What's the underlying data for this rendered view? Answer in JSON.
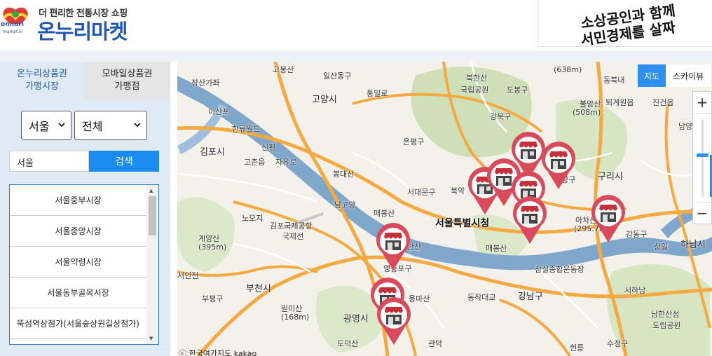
{
  "header": {
    "tagline": "더 편리한 전통시장 쇼핑",
    "brand": "온누리마켓",
    "badge_word": "onnuri",
    "badge_sub": "market.kr",
    "slogan_line1": "소상공인과 함께",
    "slogan_line2": "서민경제를 살짜"
  },
  "sidebar": {
    "tabs": [
      {
        "label": "온누리상품권\n가맹시장",
        "active": true
      },
      {
        "label": "모바일상품권\n가맹점",
        "active": false
      }
    ],
    "region_select": "서울",
    "district_select": "전체",
    "search_value": "서울",
    "search_button": "검색",
    "markets": [
      "서울중부시장",
      "서울중앙시장",
      "서울약령시장",
      "서울동부골목시장",
      "뚝섬역상점가(서울숲상원길상점가)"
    ]
  },
  "map": {
    "map_type_active": "지도",
    "map_type_other": "스카이뷰",
    "zoom_in": "+",
    "zoom_out": "−",
    "zoom_level_fraction": 0.55,
    "copyright": "ⓒ 한국여가지도 kakao",
    "labels": [
      "고봉산",
      "장산가좌",
      "일산동구",
      "고양시",
      "통일로",
      "북한산",
      "국립공원",
      "도봉구",
      "(638m)",
      "동북내",
      "지도",
      "퇴계원읍",
      "진건읍",
      "이산포",
      "한류월드",
      "김포시",
      "고촌읍",
      "자유로",
      "신평",
      "봉대산",
      "은평구",
      "강북구",
      "불암산",
      "(508m)",
      "남양주",
      "서대문구",
      "북악",
      "구리시",
      "중랑구",
      "노오지",
      "남고양",
      "매봉산",
      "서울특별시청",
      "아차산",
      "(295.7m)",
      "계양산",
      "(395m)",
      "김포국제공항",
      "국제선",
      "부천시",
      "서인천",
      "영등포구",
      "매봉산",
      "안산",
      "강동구",
      "하남시",
      "상일",
      "잠실종합운동장",
      "강남구",
      "서하남",
      "부평구",
      "원미산",
      "(168m)",
      "광명시",
      "용마산",
      "동작대교",
      "관악",
      "남한산성",
      "도립공원",
      "도덕산",
      "수정구",
      "헌릉"
    ],
    "colors": {
      "water": "#7fa7cc",
      "highway": "#f6a941",
      "road": "#ffffff",
      "park": "#cfe0b8",
      "marker": "#d94a5a"
    }
  }
}
